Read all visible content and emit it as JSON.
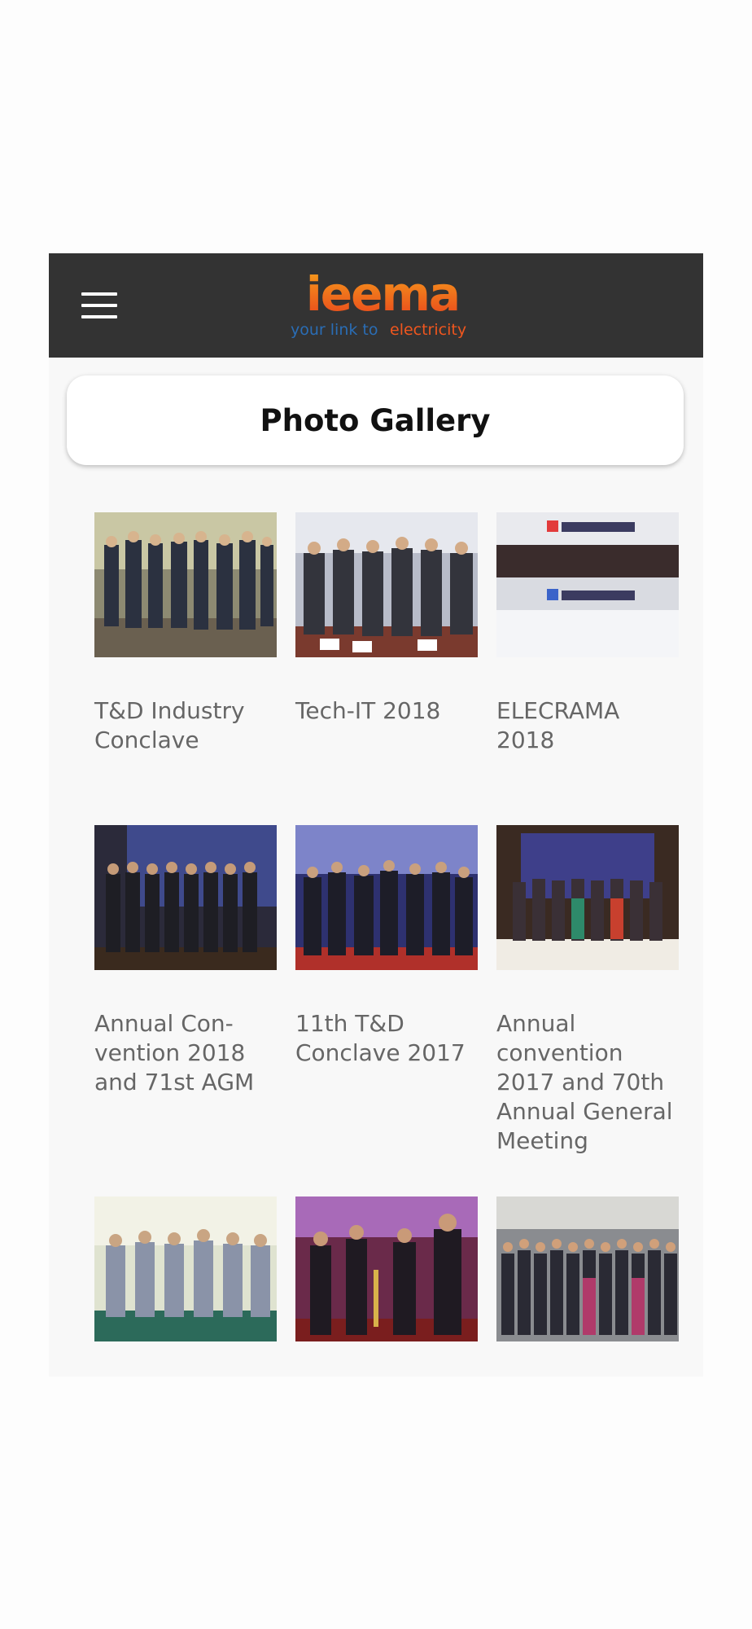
{
  "header": {
    "logo_text": "ieema",
    "logo_tagline_blue": "your link to",
    "logo_tagline_orange": "electricity",
    "menu_icon": "hamburger-menu-icon"
  },
  "page": {
    "title": "Photo Gallery"
  },
  "gallery": {
    "items": [
      {
        "caption": "T&D Industry Conclave"
      },
      {
        "caption": "Tech-IT 2018"
      },
      {
        "caption": "ELECRAMA 2018"
      },
      {
        "caption": "Annual Con-vention 2018 and 71st AGM"
      },
      {
        "caption": "11th T&D Conclave 2017"
      },
      {
        "caption": "Annual convention 2017 and 70th Annual General Meeting"
      },
      {
        "caption": ""
      },
      {
        "caption": ""
      },
      {
        "caption": ""
      }
    ]
  },
  "colors": {
    "header_bg": "#333333",
    "logo_orange": "#f0561e",
    "logo_blue": "#2a6db5",
    "caption": "#666666"
  }
}
